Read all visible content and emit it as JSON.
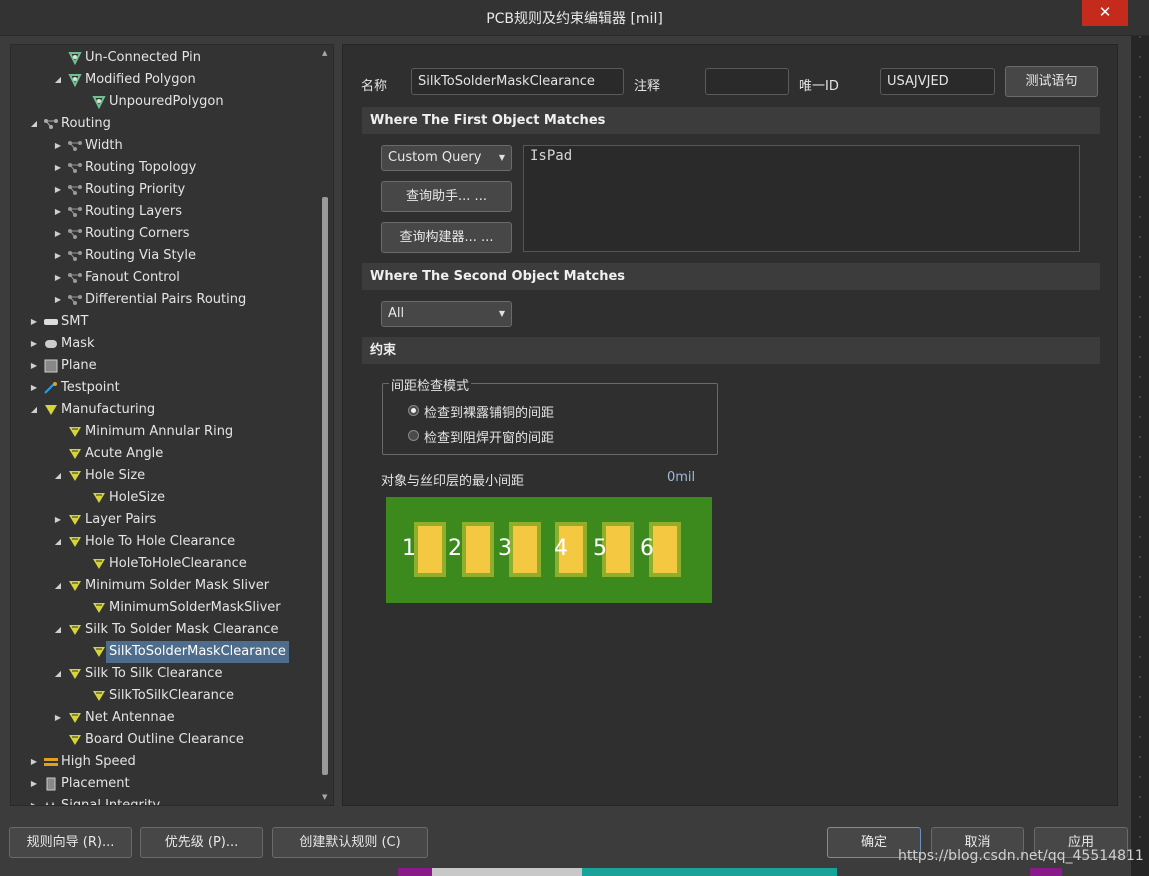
{
  "window": {
    "title": "PCB规则及约束编辑器 [mil]",
    "close_glyph": "✕"
  },
  "tree": {
    "items": [
      {
        "label": "Un-Connected Pin",
        "arrow": "",
        "icon": "rule-icon"
      },
      {
        "label": "Modified Polygon",
        "arrow": "◢",
        "icon": "rule-icon"
      },
      {
        "label": "UnpouredPolygon",
        "arrow": "",
        "icon": "rule-icon"
      },
      {
        "label": "Routing",
        "arrow": "◢",
        "icon": "routing-category-icon"
      },
      {
        "label": "Width",
        "arrow": "▶",
        "icon": "routing-rule-icon"
      },
      {
        "label": "Routing Topology",
        "arrow": "▶",
        "icon": "routing-rule-icon"
      },
      {
        "label": "Routing Priority",
        "arrow": "▶",
        "icon": "routing-rule-icon"
      },
      {
        "label": "Routing Layers",
        "arrow": "▶",
        "icon": "routing-rule-icon"
      },
      {
        "label": "Routing Corners",
        "arrow": "▶",
        "icon": "routing-rule-icon"
      },
      {
        "label": "Routing Via Style",
        "arrow": "▶",
        "icon": "routing-rule-icon"
      },
      {
        "label": "Fanout Control",
        "arrow": "▶",
        "icon": "routing-rule-icon"
      },
      {
        "label": "Differential Pairs Routing",
        "arrow": "▶",
        "icon": "routing-rule-icon"
      },
      {
        "label": "SMT",
        "arrow": "▶",
        "icon": "smt-icon"
      },
      {
        "label": "Mask",
        "arrow": "▶",
        "icon": "mask-icon"
      },
      {
        "label": "Plane",
        "arrow": "▶",
        "icon": "plane-icon"
      },
      {
        "label": "Testpoint",
        "arrow": "▶",
        "icon": "testpoint-icon"
      },
      {
        "label": "Manufacturing",
        "arrow": "◢",
        "icon": "manufacturing-icon"
      },
      {
        "label": "Minimum Annular Ring",
        "arrow": "",
        "icon": "manufacturing-rule-icon"
      },
      {
        "label": "Acute Angle",
        "arrow": "",
        "icon": "manufacturing-rule-icon"
      },
      {
        "label": "Hole Size",
        "arrow": "◢",
        "icon": "manufacturing-rule-icon"
      },
      {
        "label": "HoleSize",
        "arrow": "",
        "icon": "manufacturing-rule-icon"
      },
      {
        "label": "Layer Pairs",
        "arrow": "▶",
        "icon": "manufacturing-rule-icon"
      },
      {
        "label": "Hole To Hole Clearance",
        "arrow": "◢",
        "icon": "manufacturing-rule-icon"
      },
      {
        "label": "HoleToHoleClearance",
        "arrow": "",
        "icon": "manufacturing-rule-icon"
      },
      {
        "label": "Minimum Solder Mask Sliver",
        "arrow": "◢",
        "icon": "manufacturing-rule-icon"
      },
      {
        "label": "MinimumSolderMaskSliver",
        "arrow": "",
        "icon": "manufacturing-rule-icon"
      },
      {
        "label": "Silk To Solder Mask Clearance",
        "arrow": "◢",
        "icon": "manufacturing-rule-icon"
      },
      {
        "label": "SilkToSolderMaskClearance",
        "arrow": "",
        "icon": "manufacturing-rule-icon"
      },
      {
        "label": "Silk To Silk Clearance",
        "arrow": "◢",
        "icon": "manufacturing-rule-icon"
      },
      {
        "label": "SilkToSilkClearance",
        "arrow": "",
        "icon": "manufacturing-rule-icon"
      },
      {
        "label": "Net Antennae",
        "arrow": "▶",
        "icon": "manufacturing-rule-icon"
      },
      {
        "label": "Board Outline Clearance",
        "arrow": "",
        "icon": "manufacturing-rule-icon"
      },
      {
        "label": "High Speed",
        "arrow": "▶",
        "icon": "high-speed-icon"
      },
      {
        "label": "Placement",
        "arrow": "▶",
        "icon": "placement-icon"
      },
      {
        "label": "Signal Integrity",
        "arrow": "▶",
        "icon": "signal-integrity-icon"
      }
    ],
    "selected": "SilkToSolderMaskClearance"
  },
  "rule": {
    "name_label": "名称",
    "name_value": "SilkToSolderMaskClearance",
    "comment_label": "注释",
    "comment_value": "",
    "uid_label": "唯一ID",
    "uid_value": "USAJVJED",
    "test_button": "测试语句"
  },
  "first_object": {
    "header": "Where The First Object Matches",
    "query_type": "Custom Query",
    "query_helper": "查询助手... ...",
    "query_builder": "查询构建器... ...",
    "query_text": "IsPad"
  },
  "second_object": {
    "header": "Where The Second Object Matches",
    "query_type": "All"
  },
  "constraints": {
    "header": "约束",
    "mode_group": "间距检查模式",
    "options": [
      "检查到裸露铺铜的间距",
      "检查到阻焊开窗的间距"
    ],
    "selected_option": 0,
    "min_clearance_label": "对象与丝印层的最小间距",
    "min_clearance_value": "0mil",
    "pad_numbers": [
      "1",
      "2",
      "3",
      "4",
      "5",
      "6"
    ],
    "colors": {
      "board": "#3c8a1e",
      "pad": "#f5c842",
      "pad_border": "#8fae2c"
    }
  },
  "footer": {
    "rule_wizard": "规则向导 (R)...",
    "priorities": "优先级 (P)...",
    "create_default": "创建默认规则 (C)",
    "ok": "确定",
    "cancel": "取消",
    "apply": "应用"
  },
  "watermark": "https://blog.csdn.net/qq_45514811"
}
